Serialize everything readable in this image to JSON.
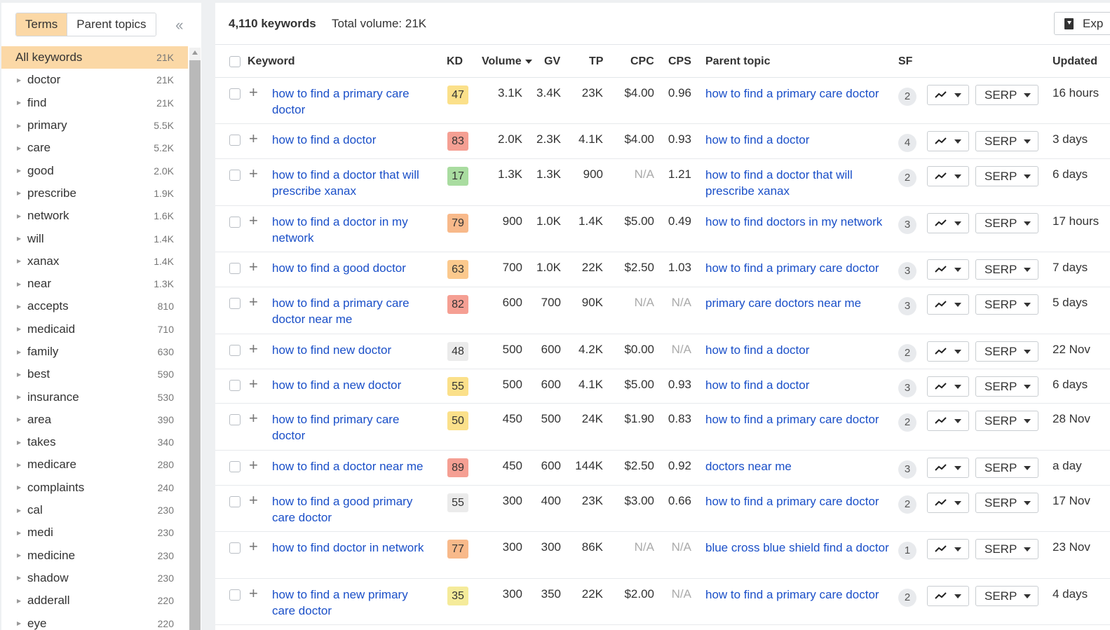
{
  "sidebar": {
    "tabs": [
      {
        "label": "Terms",
        "active": true
      },
      {
        "label": "Parent topics",
        "active": false
      }
    ],
    "collapse_icon": "double-chevron-left-icon",
    "items": [
      {
        "label": "All keywords",
        "count": "21K",
        "selected": true
      },
      {
        "label": "doctor",
        "count": "21K"
      },
      {
        "label": "find",
        "count": "21K"
      },
      {
        "label": "primary",
        "count": "5.5K"
      },
      {
        "label": "care",
        "count": "5.2K"
      },
      {
        "label": "good",
        "count": "2.0K"
      },
      {
        "label": "prescribe",
        "count": "1.9K"
      },
      {
        "label": "network",
        "count": "1.6K"
      },
      {
        "label": "will",
        "count": "1.4K"
      },
      {
        "label": "xanax",
        "count": "1.4K"
      },
      {
        "label": "near",
        "count": "1.3K"
      },
      {
        "label": "accepts",
        "count": "810"
      },
      {
        "label": "medicaid",
        "count": "710"
      },
      {
        "label": "family",
        "count": "630"
      },
      {
        "label": "best",
        "count": "590"
      },
      {
        "label": "insurance",
        "count": "530"
      },
      {
        "label": "area",
        "count": "390"
      },
      {
        "label": "takes",
        "count": "340"
      },
      {
        "label": "medicare",
        "count": "280"
      },
      {
        "label": "complaints",
        "count": "240"
      },
      {
        "label": "cal",
        "count": "230"
      },
      {
        "label": "medi",
        "count": "230"
      },
      {
        "label": "medicine",
        "count": "230"
      },
      {
        "label": "shadow",
        "count": "230"
      },
      {
        "label": "adderall",
        "count": "220"
      },
      {
        "label": "eye",
        "count": "220"
      }
    ]
  },
  "header": {
    "keywords_count": "4,110 keywords",
    "total_volume": "Total volume: 21K",
    "export_label": "Exp"
  },
  "table": {
    "columns": {
      "keyword": "Keyword",
      "kd": "KD",
      "volume": "Volume",
      "gv": "GV",
      "tp": "TP",
      "cpc": "CPC",
      "cps": "CPS",
      "parent_topic": "Parent topic",
      "sf": "SF",
      "updated": "Updated"
    },
    "serp_label": "SERP",
    "rows": [
      {
        "keyword": "how to find a primary care doctor",
        "kd": "47",
        "kd_color": "#fbe08a",
        "volume": "3.1K",
        "gv": "3.4K",
        "tp": "23K",
        "cpc": "$4.00",
        "cps": "0.96",
        "parent": "how to find a primary care doctor",
        "sf": "2",
        "updated": "16 hours",
        "h": 66
      },
      {
        "keyword": "how to find a doctor",
        "kd": "83",
        "kd_color": "#f59f93",
        "volume": "2.0K",
        "gv": "2.3K",
        "tp": "4.1K",
        "cpc": "$4.00",
        "cps": "0.93",
        "parent": "how to find a doctor",
        "sf": "4",
        "updated": "3 days",
        "h": 50
      },
      {
        "keyword": "how to find a doctor that will prescribe xanax",
        "kd": "17",
        "kd_color": "#a9dca0",
        "volume": "1.3K",
        "gv": "1.3K",
        "tp": "900",
        "cpc": "N/A",
        "cps": "1.21",
        "parent": "how to find a doctor that will prescribe xanax",
        "sf": "2",
        "updated": "6 days",
        "h": 67
      },
      {
        "keyword": "how to find a doctor in my network",
        "kd": "79",
        "kd_color": "#f8b98a",
        "volume": "900",
        "gv": "1.0K",
        "tp": "1.4K",
        "cpc": "$5.00",
        "cps": "0.49",
        "parent": "how to find doctors in my network",
        "sf": "3",
        "updated": "17 hours",
        "h": 66
      },
      {
        "keyword": "how to find a good doctor",
        "kd": "63",
        "kd_color": "#fbc98d",
        "volume": "700",
        "gv": "1.0K",
        "tp": "22K",
        "cpc": "$2.50",
        "cps": "1.03",
        "parent": "how to find a primary care doctor",
        "sf": "3",
        "updated": "7 days",
        "h": 50
      },
      {
        "keyword": "how to find a primary care doctor near me",
        "kd": "82",
        "kd_color": "#f59f93",
        "volume": "600",
        "gv": "700",
        "tp": "90K",
        "cpc": "N/A",
        "cps": "N/A",
        "parent": "primary care doctors near me",
        "sf": "3",
        "updated": "5 days",
        "h": 67
      },
      {
        "keyword": "how to find new doctor",
        "kd": "48",
        "kd_color": "#ebebeb",
        "volume": "500",
        "gv": "600",
        "tp": "4.2K",
        "cpc": "$0.00",
        "cps": "N/A",
        "parent": "how to find a doctor",
        "sf": "2",
        "updated": "22 Nov",
        "h": 50
      },
      {
        "keyword": "how to find a new doctor",
        "kd": "55",
        "kd_color": "#fbe08a",
        "volume": "500",
        "gv": "600",
        "tp": "4.1K",
        "cpc": "$5.00",
        "cps": "0.93",
        "parent": "how to find a doctor",
        "sf": "3",
        "updated": "6 days",
        "h": 49
      },
      {
        "keyword": "how to find primary care doctor",
        "kd": "50",
        "kd_color": "#fbe08a",
        "volume": "450",
        "gv": "500",
        "tp": "24K",
        "cpc": "$1.90",
        "cps": "0.83",
        "parent": "how to find a primary care doctor",
        "sf": "2",
        "updated": "28 Nov",
        "h": 67
      },
      {
        "keyword": "how to find a doctor near me",
        "kd": "89",
        "kd_color": "#f59f93",
        "volume": "450",
        "gv": "600",
        "tp": "144K",
        "cpc": "$2.50",
        "cps": "0.92",
        "parent": "doctors near me",
        "sf": "3",
        "updated": "a day",
        "h": 50
      },
      {
        "keyword": "how to find a good primary care doctor",
        "kd": "55",
        "kd_color": "#ebebeb",
        "volume": "300",
        "gv": "400",
        "tp": "23K",
        "cpc": "$3.00",
        "cps": "0.66",
        "parent": "how to find a primary care doctor",
        "sf": "2",
        "updated": "17 Nov",
        "h": 66
      },
      {
        "keyword": "how to find doctor in network",
        "kd": "77",
        "kd_color": "#f8b98a",
        "volume": "300",
        "gv": "300",
        "tp": "86K",
        "cpc": "N/A",
        "cps": "N/A",
        "parent": "blue cross blue shield find a doctor",
        "sf": "1",
        "updated": "23 Nov",
        "h": 67
      },
      {
        "keyword": "how to find a new primary care doctor",
        "kd": "35",
        "kd_color": "#f5eb9a",
        "volume": "300",
        "gv": "350",
        "tp": "22K",
        "cpc": "$2.00",
        "cps": "N/A",
        "parent": "how to find a primary care doctor",
        "sf": "2",
        "updated": "4 days",
        "h": 66
      }
    ]
  }
}
